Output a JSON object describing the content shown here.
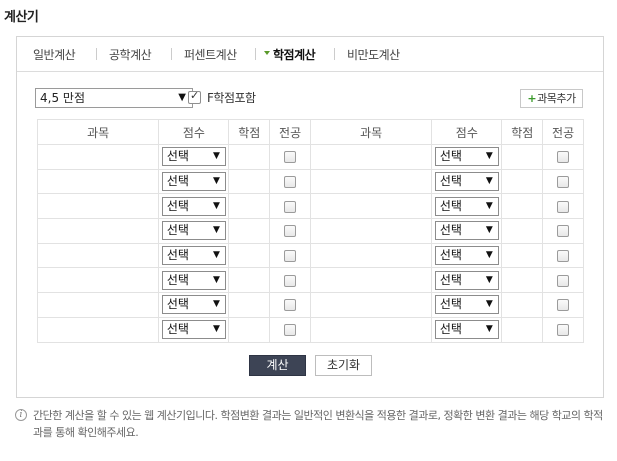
{
  "title": "계산기",
  "tabs": [
    {
      "label": "일반계산"
    },
    {
      "label": "공학계산"
    },
    {
      "label": "퍼센트계산"
    },
    {
      "label": "학점계산"
    },
    {
      "label": "비만도계산"
    }
  ],
  "active_tab": "학점계산",
  "scale_select": {
    "value": "4,5 만점"
  },
  "f_grade": {
    "label": "F학점포함",
    "checked": true
  },
  "add_button": {
    "label": "과목추가"
  },
  "table": {
    "headers": [
      "과목",
      "점수",
      "학점",
      "전공",
      "과목",
      "점수",
      "학점",
      "전공"
    ],
    "rows": [
      {
        "left_score": "선택",
        "right_score": "선택"
      },
      {
        "left_score": "선택",
        "right_score": "선택"
      },
      {
        "left_score": "선택",
        "right_score": "선택"
      },
      {
        "left_score": "선택",
        "right_score": "선택"
      },
      {
        "left_score": "선택",
        "right_score": "선택"
      },
      {
        "left_score": "선택",
        "right_score": "선택"
      },
      {
        "left_score": "선택",
        "right_score": "선택"
      },
      {
        "left_score": "선택",
        "right_score": "선택"
      }
    ]
  },
  "buttons": {
    "calculate": "계산",
    "reset": "초기화"
  },
  "info": {
    "icon": "info-icon",
    "text": "간단한 계산을 할 수 있는 웹 계산기입니다. 학점변환 결과는 일반적인 변환식을 적용한 결과로, 정확한 변환 결과는 해당 학교의 학적과를 통해 확인해주세요."
  },
  "colors": {
    "accent_green": "#3a9a2a",
    "calc_button": "#3d4455"
  }
}
